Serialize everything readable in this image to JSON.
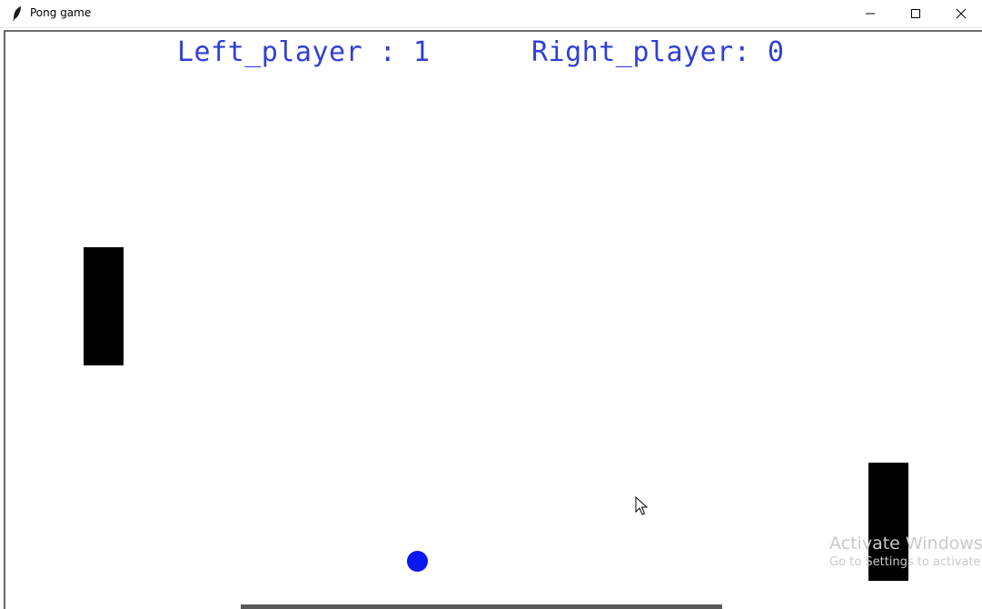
{
  "window": {
    "title": "Pong game",
    "icons": {
      "app": "feather-icon",
      "minimize": "minimize-icon",
      "maximize": "maximize-icon",
      "close": "close-icon"
    }
  },
  "scoreboard": {
    "left_text": "Left_player : 1",
    "right_text": "Right_player: 0",
    "left_score": 1,
    "right_score": 0,
    "color": "#2f3fd6"
  },
  "game": {
    "ball_color": "#0b17f2",
    "paddle_color": "#000000",
    "background": "#ffffff"
  },
  "watermark": {
    "line1": "Activate Windows",
    "line2": "Go to Settings to activate"
  }
}
